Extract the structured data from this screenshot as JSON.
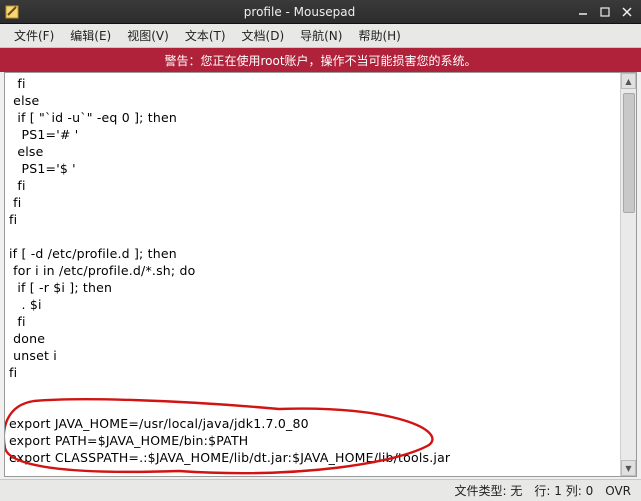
{
  "window": {
    "title": "profile - Mousepad"
  },
  "menu": {
    "file": "文件(F)",
    "edit": "编辑(E)",
    "view": "视图(V)",
    "text": "文本(T)",
    "document": "文档(D)",
    "navigation": "导航(N)",
    "help": "帮助(H)"
  },
  "warning": "警告：您正在使用root账户，操作不当可能损害您的系统。",
  "editor_text": "  fi\n else\n  if [ \"`id -u`\" -eq 0 ]; then\n   PS1='# '\n  else\n   PS1='$ '\n  fi\n fi\nfi\n\nif [ -d /etc/profile.d ]; then\n for i in /etc/profile.d/*.sh; do\n  if [ -r $i ]; then\n   . $i\n  fi\n done\n unset i\nfi\n\n\nexport JAVA_HOME=/usr/local/java/jdk1.7.0_80\nexport PATH=$JAVA_HOME/bin:$PATH\nexport CLASSPATH=.:$JAVA_HOME/lib/dt.jar:$JAVA_HOME/lib/tools.jar",
  "status": {
    "filetype": "文件类型: 无",
    "position": "行: 1 列: 0",
    "ovr": "OVR"
  }
}
